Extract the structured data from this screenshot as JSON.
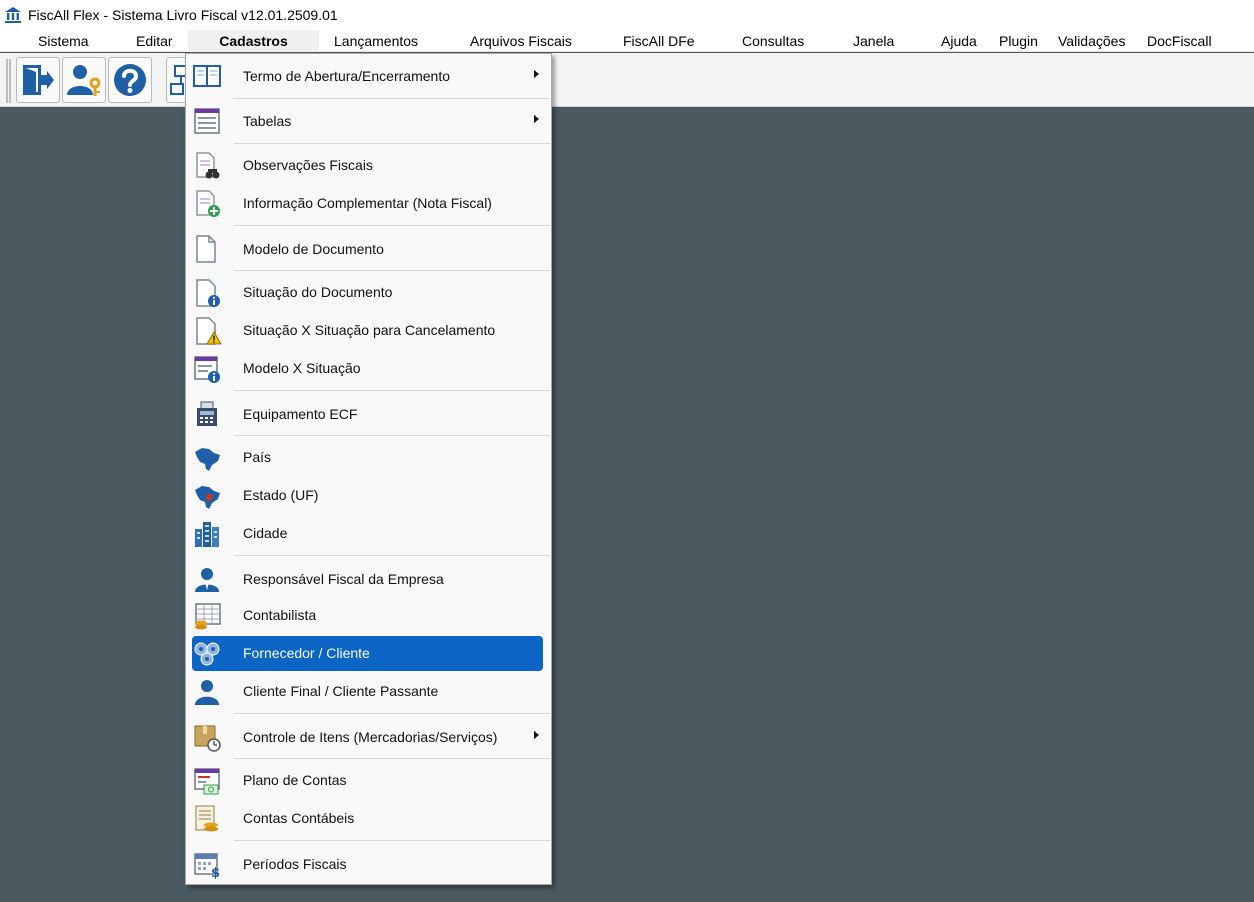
{
  "window": {
    "title": "FiscAll Flex - Sistema Livro Fiscal v12.01.2509.01"
  },
  "menubar": [
    {
      "label": "Sistema"
    },
    {
      "label": "Editar"
    },
    {
      "label": "Cadastros"
    },
    {
      "label": "Lançamentos"
    },
    {
      "label": "Arquivos Fiscais"
    },
    {
      "label": "FiscAll DFe"
    },
    {
      "label": "Consultas"
    },
    {
      "label": "Janela"
    },
    {
      "label": "Ajuda"
    },
    {
      "label": "Plugin"
    },
    {
      "label": "Validações"
    },
    {
      "label": "DocFiscall"
    }
  ],
  "open_menu": "Cadastros",
  "toolbar": [
    {
      "icon": "exit-door-icon"
    },
    {
      "icon": "user-key-icon"
    },
    {
      "icon": "help-icon"
    },
    {
      "icon": "structure-icon"
    }
  ],
  "cadastros_menu": [
    {
      "label": "Termo de Abertura/Encerramento",
      "icon": "book-icon",
      "submenu": true
    },
    {
      "label": "Tabelas",
      "icon": "table-list-icon",
      "submenu": true
    },
    {
      "label": "Observações Fiscais",
      "icon": "document-binoculars-icon"
    },
    {
      "label": "Informação Complementar (Nota Fiscal)",
      "icon": "document-add-icon"
    },
    {
      "label": "Modelo de Documento",
      "icon": "blank-document-icon"
    },
    {
      "label": "Situação do Documento",
      "icon": "document-info-icon"
    },
    {
      "label": "Situação X Situação para Cancelamento",
      "icon": "document-warning-icon"
    },
    {
      "label": "Modelo X Situação",
      "icon": "list-info-icon"
    },
    {
      "label": "Equipamento ECF",
      "icon": "cash-register-icon"
    },
    {
      "label": "País",
      "icon": "brazil-map-icon"
    },
    {
      "label": "Estado (UF)",
      "icon": "brazil-state-map-icon"
    },
    {
      "label": "Cidade",
      "icon": "city-buildings-icon"
    },
    {
      "label": "Responsável Fiscal da Empresa",
      "icon": "person-icon"
    },
    {
      "label": "Contabilista",
      "icon": "spreadsheet-coins-icon"
    },
    {
      "label": "Fornecedor / Cliente",
      "icon": "network-people-icon",
      "highlighted": true
    },
    {
      "label": "Cliente Final / Cliente Passante",
      "icon": "person-blue-icon"
    },
    {
      "label": "Controle de Itens (Mercadorias/Serviços)",
      "icon": "box-clock-icon",
      "submenu": true
    },
    {
      "label": "Plano de Contas",
      "icon": "accounts-plan-icon"
    },
    {
      "label": "Contas Contábeis",
      "icon": "ledger-coins-icon"
    },
    {
      "label": "Períodos Fiscais",
      "icon": "calendar-dollar-icon"
    }
  ]
}
